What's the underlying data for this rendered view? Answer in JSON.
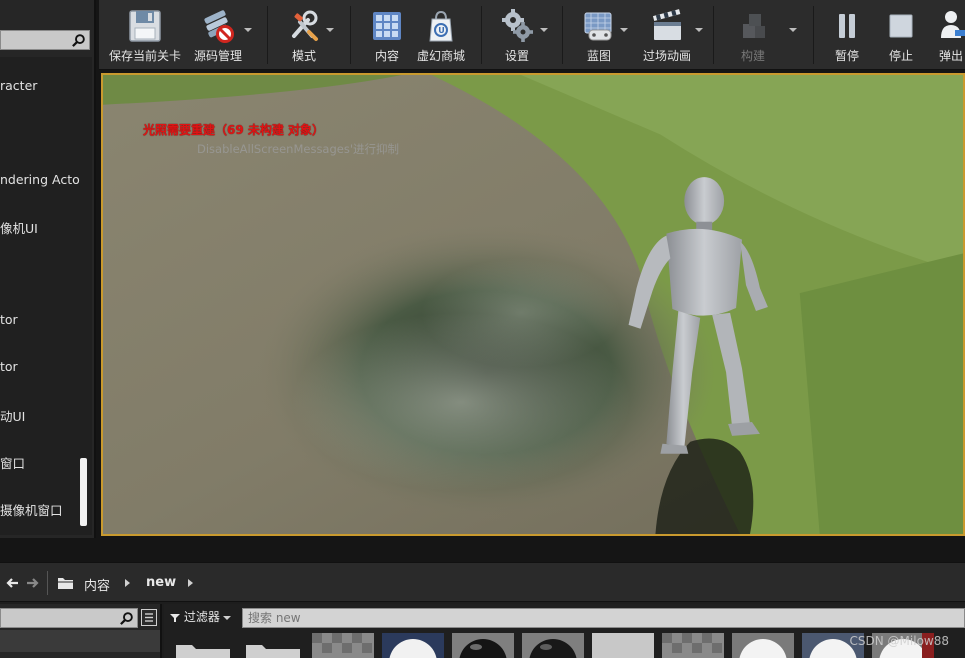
{
  "outliner": {
    "search_placeholder": "",
    "items": [
      {
        "label": "racter"
      },
      {
        "label": "ndering Acto"
      },
      {
        "label": "像机UI"
      },
      {
        "label": "tor"
      },
      {
        "label": "tor"
      },
      {
        "label": "动UI"
      },
      {
        "label": "窗口"
      },
      {
        "label": "摄像机窗口"
      }
    ]
  },
  "toolbar": {
    "buttons": [
      {
        "label": "保存当前关卡",
        "icon": "floppy-disk-icon",
        "dropdown": false,
        "enabled": true
      },
      {
        "label": "源码管理",
        "icon": "source-control-icon",
        "dropdown": true,
        "enabled": true
      },
      {
        "label": "模式",
        "icon": "modes-icon",
        "dropdown": true,
        "enabled": true
      },
      {
        "label": "内容",
        "icon": "content-grid-icon",
        "dropdown": false,
        "enabled": true
      },
      {
        "label": "虚幻商城",
        "icon": "marketplace-bag-icon",
        "dropdown": false,
        "enabled": true
      },
      {
        "label": "设置",
        "icon": "gear-icon",
        "dropdown": true,
        "enabled": true
      },
      {
        "label": "蓝图",
        "icon": "blueprint-icon",
        "dropdown": true,
        "enabled": true
      },
      {
        "label": "过场动画",
        "icon": "clapperboard-icon",
        "dropdown": true,
        "enabled": true
      },
      {
        "label": "构建",
        "icon": "build-blocks-icon",
        "dropdown": true,
        "enabled": false
      },
      {
        "label": "暂停",
        "icon": "pause-icon",
        "dropdown": false,
        "enabled": true
      },
      {
        "label": "停止",
        "icon": "stop-icon",
        "dropdown": false,
        "enabled": true
      },
      {
        "label": "弹出",
        "icon": "eject-player-icon",
        "dropdown": false,
        "enabled": true
      }
    ]
  },
  "viewport": {
    "lighting_warning": "光照需要重建（69 未构建 对象）",
    "disable_hint": "DisableAllScreenMessages'进行抑制"
  },
  "content_browser": {
    "path": [
      "内容",
      "new"
    ],
    "filter_label": "过滤器",
    "search_placeholder": "搜索 new",
    "tree_search_placeholder": "",
    "assets": [
      {
        "kind": "folder"
      },
      {
        "kind": "folder"
      },
      {
        "kind": "checker-material"
      },
      {
        "kind": "white-sphere-material"
      },
      {
        "kind": "black-sphere-material"
      },
      {
        "kind": "black-sphere-material"
      },
      {
        "kind": "grey-flat-material"
      },
      {
        "kind": "checker-material"
      },
      {
        "kind": "white-sphere-material"
      },
      {
        "kind": "white-sphere-material"
      },
      {
        "kind": "white-sphere-material"
      }
    ]
  },
  "watermark": "CSDN @Milow88",
  "colors": {
    "viewport_border": "#c99a2e",
    "warning_text": "#e01414",
    "toolbar_bg": "#2c2c2c"
  }
}
